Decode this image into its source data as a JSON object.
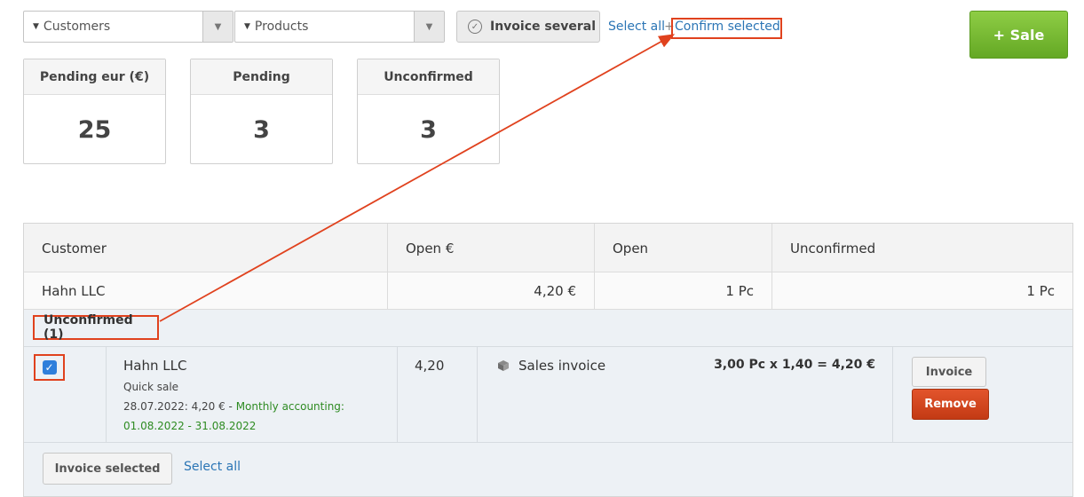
{
  "filters": {
    "customers_label": "Customers",
    "products_label": "Products"
  },
  "toolbar": {
    "invoice_several_label": "Invoice several",
    "select_all_label": "Select all",
    "plus_separator": "+",
    "confirm_selected_label": "Confirm selected",
    "sale_button_label": "+ Sale"
  },
  "stats": [
    {
      "label": "Pending eur (€)",
      "value": "25"
    },
    {
      "label": "Pending",
      "value": "3"
    },
    {
      "label": "Unconfirmed",
      "value": "3"
    }
  ],
  "table": {
    "headers": [
      "Customer",
      "Open €",
      "Open",
      "Unconfirmed"
    ],
    "rows": [
      {
        "customer": "Hahn LLC",
        "open_eur": "4,20 €",
        "open": "1 Pc",
        "unconfirmed": "1 Pc"
      }
    ]
  },
  "unconfirmed_group": {
    "label": "Unconfirmed (1)",
    "item": {
      "customer": "Hahn LLC",
      "subtitle": "Quick sale",
      "date_amount": "28.07.2022: 4,20 € - ",
      "accounting_label": "Monthly accounting:",
      "period": "01.08.2022 - 31.08.2022",
      "amount": "4,20",
      "type": "Sales invoice",
      "calculation": "3,00 Pc x 1,40 = 4,20 €",
      "invoice_button": "Invoice",
      "remove_button": "Remove"
    }
  },
  "footer": {
    "invoice_selected_label": "Invoice selected",
    "select_all_label": "Select all"
  },
  "colors": {
    "accent_link": "#2b75b5",
    "sale_green": "#64a824",
    "remove_red": "#c33a14",
    "annotation": "#e0421e"
  }
}
